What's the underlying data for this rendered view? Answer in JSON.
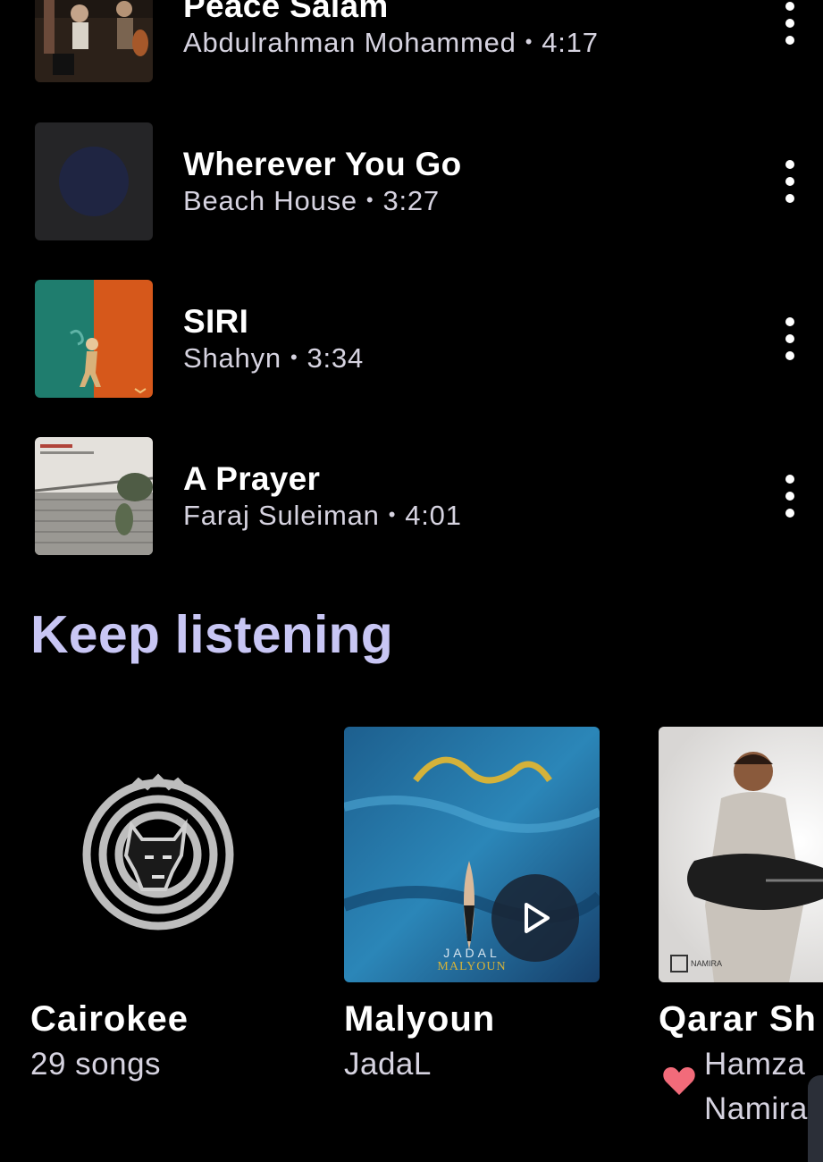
{
  "songs": [
    {
      "title": "Peace Salam",
      "artist": "Abdulrahman Mohammed",
      "duration": "4:17"
    },
    {
      "title": "Wherever You Go",
      "artist": "Beach House",
      "duration": "3:27"
    },
    {
      "title": "SIRI",
      "artist": "Shahyn",
      "duration": "3:34"
    },
    {
      "title": "A Prayer",
      "artist": "Faraj Suleiman",
      "duration": "4:01"
    }
  ],
  "meta_separator": "•",
  "section": {
    "title": "Keep listening"
  },
  "cards": [
    {
      "title": "Cairokee",
      "subtitle": "29 songs"
    },
    {
      "title": "Malyoun",
      "subtitle": "JadaL",
      "art_text": "JADAL",
      "art_text2": "MALYOUN"
    },
    {
      "title": "Qarar Sh",
      "subtitle": "Hamza",
      "subtitle2": "Namira",
      "art_text": "NAMIRA"
    }
  ],
  "colors": {
    "background": "#000000",
    "accent": "#c8c6f4",
    "secondary_text": "#d6d3e0",
    "heart": "#f26b7a"
  },
  "icons": {
    "more": "more-vert-icon",
    "play": "play-icon",
    "heart": "heart-icon"
  }
}
